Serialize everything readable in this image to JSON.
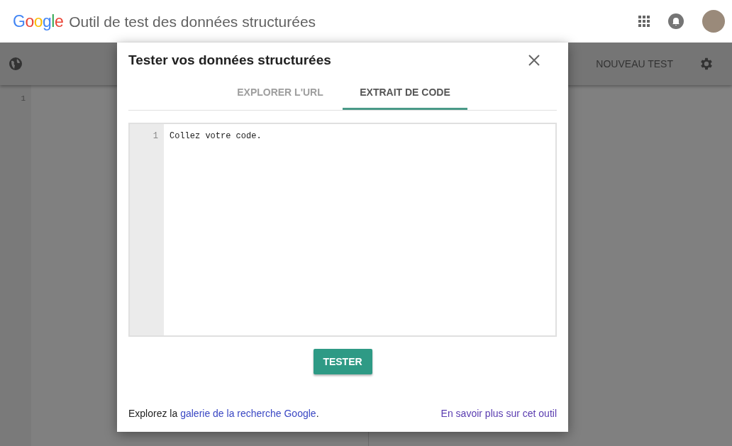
{
  "header": {
    "logo": "Google",
    "title": "Outil de test des données structurées"
  },
  "toolbar": {
    "new_test": "NOUVEAU TEST"
  },
  "background_editor": {
    "line_number": "1"
  },
  "dialog": {
    "title": "Tester vos données structurées",
    "tabs": [
      {
        "label": "EXPLORER L'URL",
        "selected": false
      },
      {
        "label": "EXTRAIT DE CODE",
        "selected": true
      }
    ],
    "editor": {
      "line_number": "1",
      "placeholder": "Collez votre code."
    },
    "submit": "TESTER",
    "footer": {
      "prefix": "Explorez la ",
      "link": "galerie de la recherche Google",
      "suffix": ".",
      "learn_more": "En savoir plus sur cet outil"
    }
  }
}
